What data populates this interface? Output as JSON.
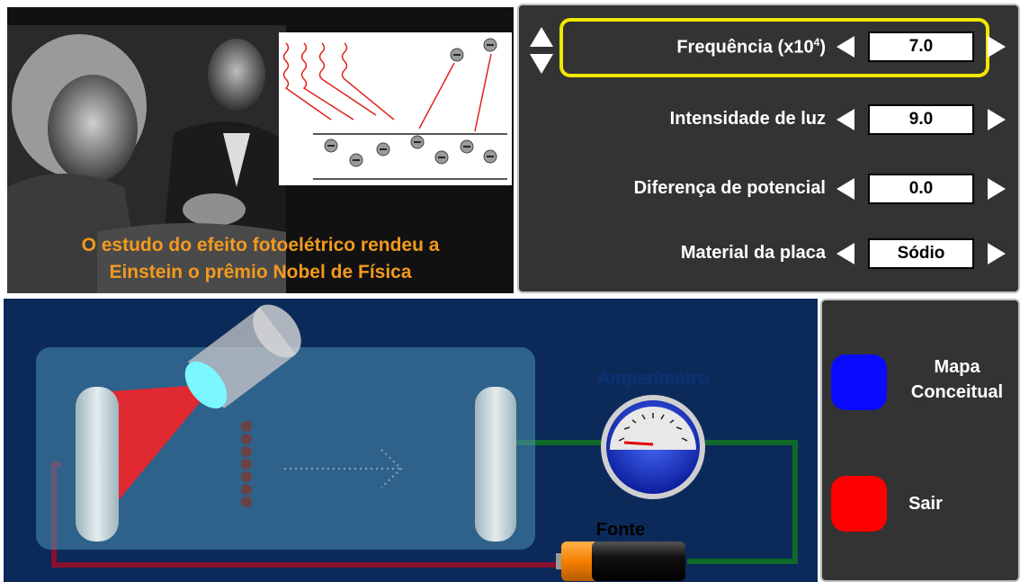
{
  "photo": {
    "caption_line1": "O estudo do efeito fotoelétrico rendeu a",
    "caption_line2": "Einstein o prêmio Nobel de Física"
  },
  "controls": {
    "frequency": {
      "label_prefix": "Frequência (x10",
      "label_sup": "4",
      "label_suffix": ")",
      "value": "7.0"
    },
    "intensity": {
      "label": "Intensidade de luz",
      "value": "9.0"
    },
    "potential": {
      "label": "Diferença de potencial",
      "value": "0.0"
    },
    "material": {
      "label": "Material da placa",
      "value": "Sódio"
    }
  },
  "simulation": {
    "ammeter_label": "Amperímetro",
    "source_label": "Fonte"
  },
  "menu": {
    "concept_map_line1": "Mapa",
    "concept_map_line2": "Conceitual",
    "exit_label": "Sair"
  },
  "colors": {
    "caption": "#f39a1e",
    "highlight": "#f2e700",
    "panel": "#333333",
    "concept_map_button": "#0a0aff",
    "exit_button": "#ff0000",
    "wire_green": "#0f6a2a",
    "wire_red": "#8a1030"
  },
  "icons": [
    "up-down-arrow-icon",
    "left-arrow-icon",
    "right-arrow-icon"
  ]
}
